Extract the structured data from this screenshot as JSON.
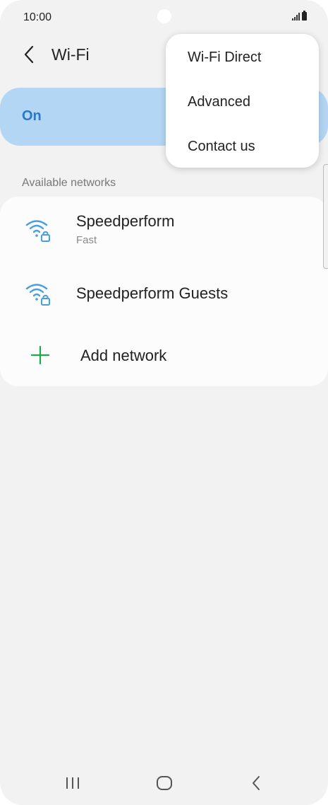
{
  "status_bar": {
    "time": "10:00"
  },
  "header": {
    "title": "Wi-Fi"
  },
  "toggle": {
    "label": "On",
    "state": "on"
  },
  "networks": {
    "section_label": "Available networks",
    "items": [
      {
        "name": "Speedperform",
        "subtitle": "Fast",
        "icon": "wifi-lock-icon"
      },
      {
        "name": "Speedperform Guests",
        "icon": "wifi-lock-icon"
      }
    ],
    "add_label": "Add network"
  },
  "menu": {
    "items": [
      "Wi-Fi Direct",
      "Advanced",
      "Contact us"
    ]
  },
  "colors": {
    "accent": "#2a78c8",
    "toggle_bg": "#b3d6f4",
    "wifi_icon": "#4a9ee0",
    "add_icon": "#1fa84a"
  }
}
